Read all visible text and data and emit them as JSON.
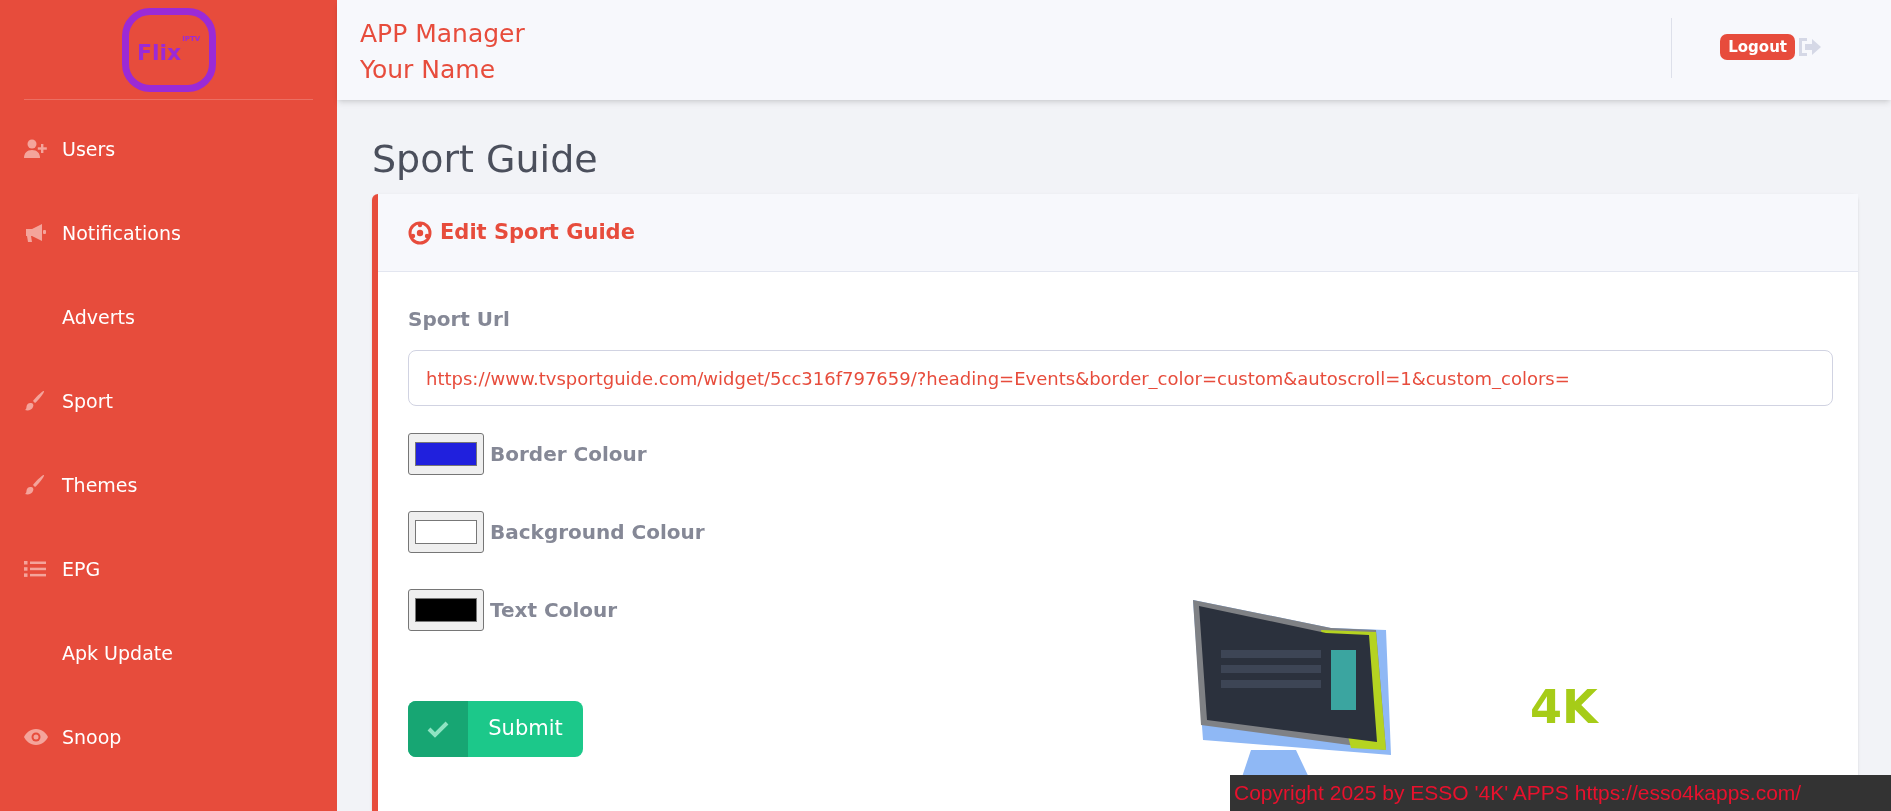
{
  "logo": {
    "text": "Flix",
    "badge": "IPTV"
  },
  "header": {
    "title": "APP Manager",
    "user": "Your Name",
    "logout": "Logout"
  },
  "sidebar": {
    "items": [
      {
        "label": "Users",
        "kind": "user"
      },
      {
        "label": "Notifications",
        "kind": "alert"
      },
      {
        "label": "Adverts",
        "kind": "plain"
      },
      {
        "label": "Sport",
        "kind": "style"
      },
      {
        "label": "Themes",
        "kind": "style"
      },
      {
        "label": "EPG",
        "kind": "listing"
      },
      {
        "label": "Apk Update",
        "kind": "plain"
      },
      {
        "label": "Snoop",
        "kind": "watch"
      }
    ]
  },
  "page_title": "Sport Guide",
  "card": {
    "title": "Edit Sport Guide",
    "url_label": "Sport Url",
    "url_value": "https://www.tvsportguide.com/widget/5cc316f797659/?heading=Events&border_color=custom&autoscroll=1&custom_colors=",
    "colors": [
      {
        "label": "Border Colour",
        "color": "#2020dd"
      },
      {
        "label": "Background Colour",
        "color": "#ffffff"
      },
      {
        "label": "Text Colour",
        "color": "#000000"
      }
    ],
    "submit": "Submit",
    "promo_text": "4K"
  },
  "footer": "Copyright 2025  by ESSO '4K' APPS https://esso4kapps.com/"
}
